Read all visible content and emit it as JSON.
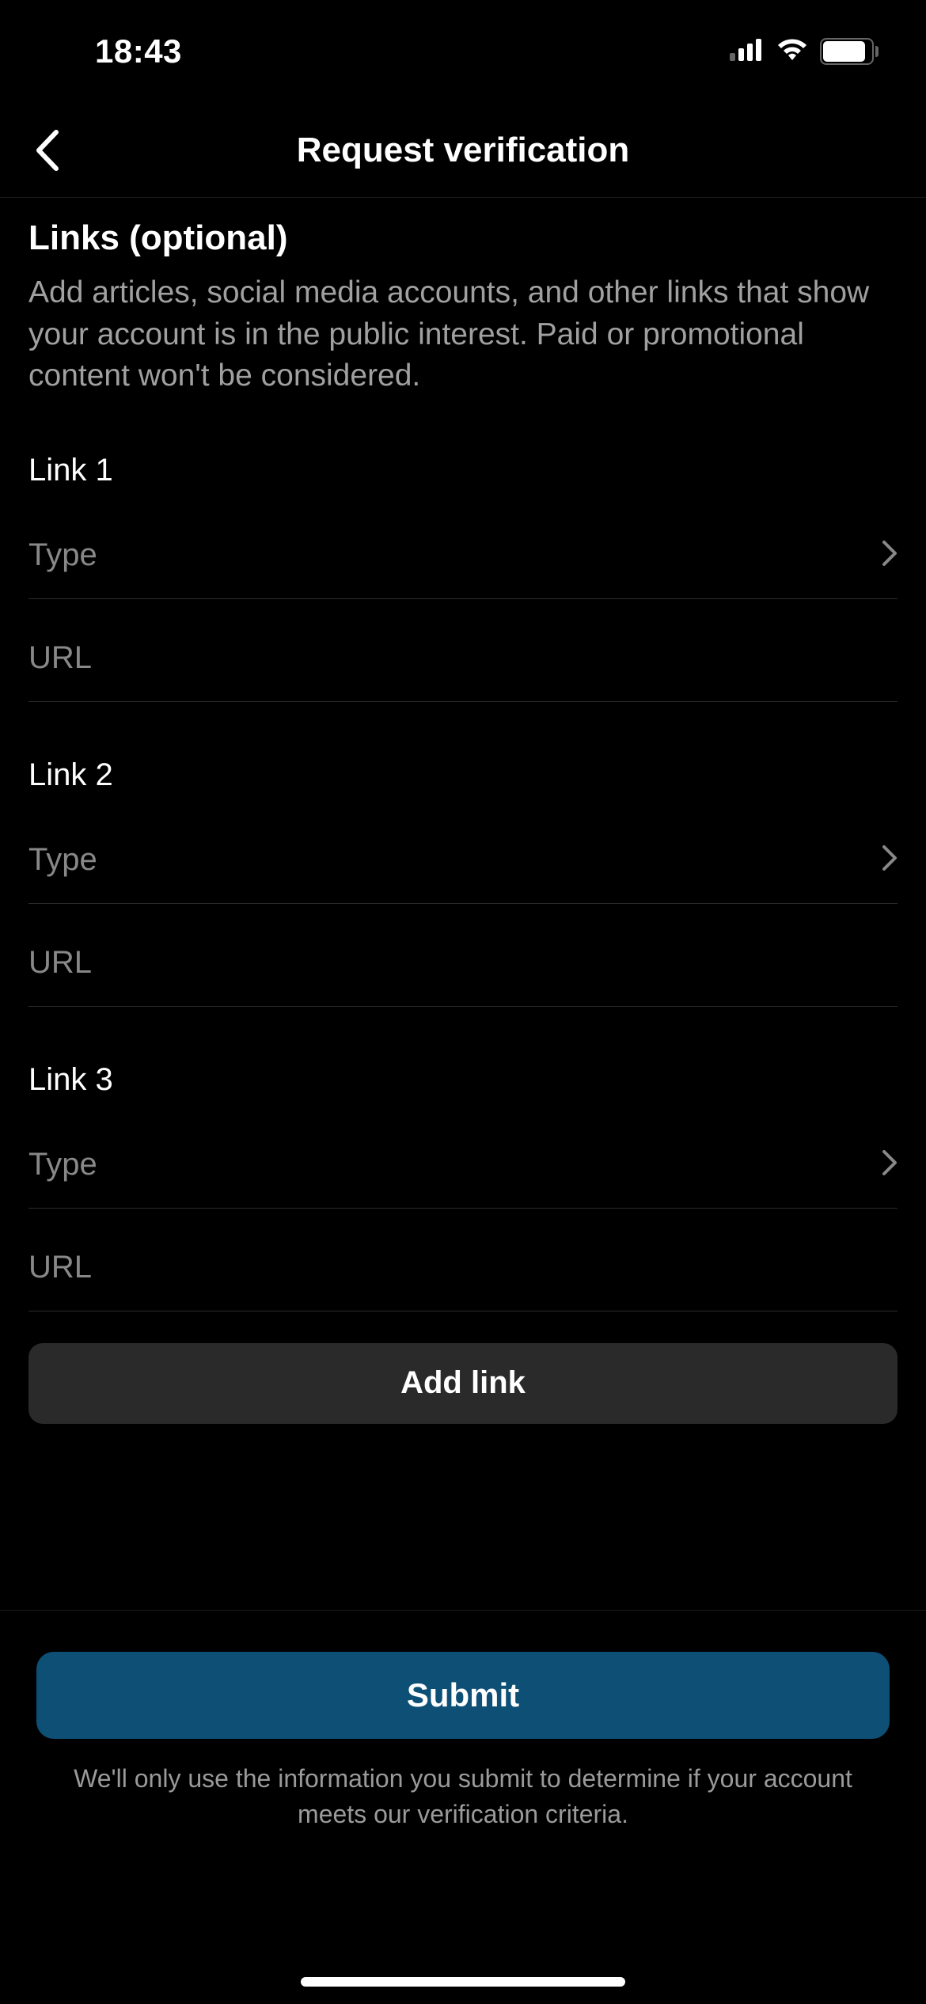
{
  "status": {
    "time": "18:43",
    "battery": "83"
  },
  "nav": {
    "title": "Request verification"
  },
  "section": {
    "title": "Links (optional)",
    "description": "Add articles, social media accounts, and other links that show your account is in the public interest. Paid or promotional content won't be considered."
  },
  "links": [
    {
      "label": "Link 1",
      "type_placeholder": "Type",
      "url_placeholder": "URL"
    },
    {
      "label": "Link 2",
      "type_placeholder": "Type",
      "url_placeholder": "URL"
    },
    {
      "label": "Link 3",
      "type_placeholder": "Type",
      "url_placeholder": "URL"
    }
  ],
  "buttons": {
    "add_link": "Add link",
    "submit": "Submit"
  },
  "footer": {
    "note": "We'll only use the information you submit to determine if your account meets our verification criteria."
  }
}
